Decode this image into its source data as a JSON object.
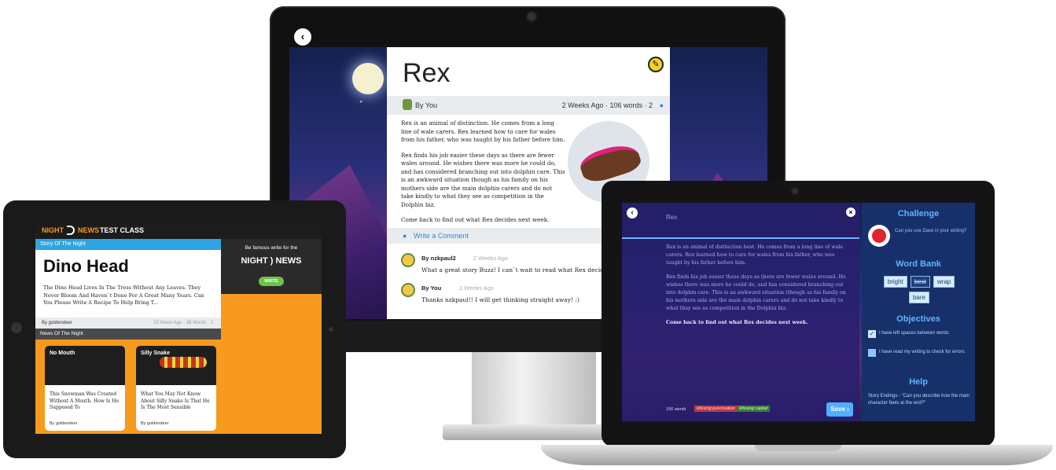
{
  "monitor": {
    "article_title": "Rex",
    "author": "By You",
    "meta": "2 Weeks Ago · 106 words · 2",
    "body": [
      "Rex is an animal of distinction. He comes from a long line of wale carers. Rex learned how to care for wales from his father, who was taught by his father before him.",
      "Rex finds his job easier these days as there are fewer wales around. He wishes there was more he could do, and has considered branching out into dolphin care. This is an awkward situation though as his family on his mothers side are the main dolphin carers and do not take kindly to what they see as competition in the Dolphin biz.",
      "Come back to find out what Rex decides next week."
    ],
    "write_comment": "Write a Comment",
    "comments": [
      {
        "author": "By nzkpaul2",
        "time": "2 Weeks Ago",
        "text": "What a great story Buzz! I can`t wait to read what Rex decides to d"
      },
      {
        "author": "By You",
        "time": "2 Weeks Ago",
        "text": "Thanks nzkpaul!! I will get thinking straight away! :)"
      }
    ]
  },
  "tablet": {
    "brand_left": "NIGHT",
    "brand_right": "NEWS",
    "class_name": "TEST CLASS",
    "story_label": "Story Of The Night",
    "story_title": "Dino Head",
    "story_text": "The Dino Head Lives In The Tress Without Any Leaves. They Never Bloom And Haven`t Done For A Great Many Years. Can You Please Write A Recipe To Help Bring T...",
    "story_author": "By goldendeer",
    "story_meta": "15 Hours Ago · 36 Words · 1",
    "promo_text": "Be famous write for the",
    "write_button": "WRITE",
    "news_label": "News Of The Night",
    "cards": [
      {
        "title": "No Mouth",
        "text": "This Snowman Was Created Without A Mouth. How Is He Supposed To",
        "author": "By goldendeer"
      },
      {
        "title": "Silly Snake",
        "text": "What You May Not Know About Silly Snake Is That He Is The Most Sensible",
        "author": "By goldendeer"
      }
    ]
  },
  "laptop": {
    "title": "Rex",
    "body": [
      "Rex is an animal of distinction best. He comes from a long line of wale carers. Rex learned how to care for wales from his father, who was taught by his father before him.",
      "Rex finds his job easier these days as there are fewer wales around. He wishes there was more he could do, and has considered branching out into dolphin care. This is an awkward situation (though as his family on his mothers side are the main dolphin carers and do not take kindly to what they see as competition in the Dolphin biz.",
      "Come back to find out what Rex decides next week."
    ],
    "word_count": "106 words",
    "tag_punctuation": "Missing punctuation",
    "tag_capital": "Missing capital",
    "save_label": "Save",
    "challenge_heading": "Challenge",
    "challenge_text": "Can you use Dave in your writing?",
    "word_bank_heading": "Word Bank",
    "word_bank": [
      "bright",
      "best",
      "wrap",
      "bare"
    ],
    "objectives_heading": "Objectives",
    "objectives": [
      {
        "text": "I have left spaces between words",
        "checked": true
      },
      {
        "text": "I have read my writing to check for errors",
        "checked": false
      }
    ],
    "help_heading": "Help",
    "help_text": "Story Endings - \"Can you describe how the main character feels at the end?\""
  },
  "colors": {
    "accent_blue": "#2b8ad6",
    "orange": "#f79a1d",
    "side_blue": "#17306a"
  }
}
